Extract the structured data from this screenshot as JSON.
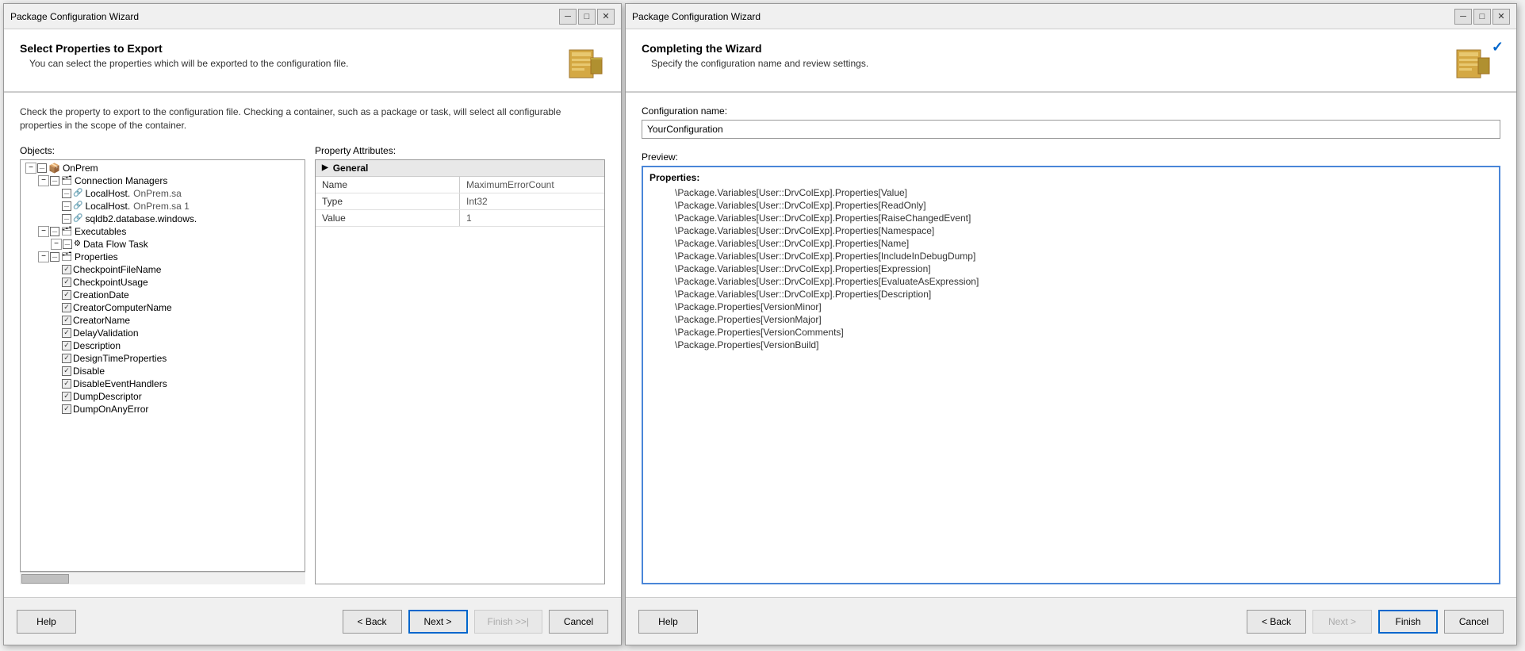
{
  "leftWizard": {
    "titleBar": {
      "title": "Package Configuration Wizard",
      "minimizeLabel": "─",
      "maximizeLabel": "□",
      "closeLabel": "✕"
    },
    "header": {
      "title": "Select Properties to Export",
      "subtitle": "You can select the properties which will be exported to the configuration file."
    },
    "description": "Check the property to export to the configuration file. Checking a container, such as a package or task, will select all configurable properties in the scope of the container.",
    "objectsLabel": "Objects:",
    "propertyAttributesLabel": "Property Attributes:",
    "tree": [
      {
        "level": 1,
        "checked": "indeterminate",
        "expanded": true,
        "text": "OnPrem",
        "type": "folder"
      },
      {
        "level": 2,
        "checked": "indeterminate",
        "expanded": true,
        "text": "Connection Managers",
        "type": "folder"
      },
      {
        "level": 3,
        "checked": "indeterminate",
        "expanded": false,
        "text": "LocalHost.",
        "value": "OnPrem.sa",
        "type": "leaf"
      },
      {
        "level": 3,
        "checked": "indeterminate",
        "expanded": false,
        "text": "LocalHost.",
        "value": "OnPrem.sa 1",
        "type": "leaf"
      },
      {
        "level": 3,
        "checked": "indeterminate",
        "expanded": false,
        "text": "",
        "value": "sqldb2.database.windows.",
        "type": "leaf"
      },
      {
        "level": 2,
        "checked": "indeterminate",
        "expanded": true,
        "text": "Executables",
        "type": "folder"
      },
      {
        "level": 3,
        "checked": "indeterminate",
        "expanded": true,
        "text": "Data Flow Task",
        "type": "folder"
      },
      {
        "level": 2,
        "checked": "indeterminate",
        "expanded": true,
        "text": "Properties",
        "type": "folder"
      },
      {
        "level": 3,
        "checked": "checked",
        "expanded": false,
        "text": "CheckpointFileName",
        "type": "prop"
      },
      {
        "level": 3,
        "checked": "checked",
        "expanded": false,
        "text": "CheckpointUsage",
        "type": "prop"
      },
      {
        "level": 3,
        "checked": "checked",
        "expanded": false,
        "text": "CreationDate",
        "type": "prop"
      },
      {
        "level": 3,
        "checked": "checked",
        "expanded": false,
        "text": "CreatorComputerName",
        "type": "prop"
      },
      {
        "level": 3,
        "checked": "checked",
        "expanded": false,
        "text": "CreatorName",
        "type": "prop"
      },
      {
        "level": 3,
        "checked": "checked",
        "expanded": false,
        "text": "DelayValidation",
        "type": "prop"
      },
      {
        "level": 3,
        "checked": "checked",
        "expanded": false,
        "text": "Description",
        "type": "prop"
      },
      {
        "level": 3,
        "checked": "checked",
        "expanded": false,
        "text": "DesignTimeProperties",
        "type": "prop"
      },
      {
        "level": 3,
        "checked": "checked",
        "expanded": false,
        "text": "Disable",
        "type": "prop"
      },
      {
        "level": 3,
        "checked": "checked",
        "expanded": false,
        "text": "DisableEventHandlers",
        "type": "prop"
      },
      {
        "level": 3,
        "checked": "checked",
        "expanded": false,
        "text": "DumpDescriptor",
        "type": "prop"
      },
      {
        "level": 3,
        "checked": "checked",
        "expanded": false,
        "text": "DumpOnAnyError",
        "type": "prop"
      }
    ],
    "propertySection": "General",
    "propertyRows": [
      {
        "label": "Name",
        "value": "MaximumErrorCount"
      },
      {
        "label": "Type",
        "value": "Int32"
      },
      {
        "label": "Value",
        "value": "1"
      }
    ],
    "footer": {
      "helpLabel": "Help",
      "backLabel": "< Back",
      "nextLabel": "Next >",
      "finishLabel": "Finish >>|",
      "cancelLabel": "Cancel"
    }
  },
  "rightWizard": {
    "titleBar": {
      "title": "Package Configuration Wizard",
      "minimizeLabel": "─",
      "maximizeLabel": "□",
      "closeLabel": "✕"
    },
    "header": {
      "title": "Completing the Wizard",
      "subtitle": "Specify the configuration name and review settings."
    },
    "configNameLabel": "Configuration name:",
    "configNameValue": "YourConfiguration",
    "previewLabel": "Preview:",
    "previewHeader": "Properties:",
    "previewItems": [
      "\\Package.Variables[User::DrvColExp].Properties[Value]",
      "\\Package.Variables[User::DrvColExp].Properties[ReadOnly]",
      "\\Package.Variables[User::DrvColExp].Properties[RaiseChangedEvent]",
      "\\Package.Variables[User::DrvColExp].Properties[Namespace]",
      "\\Package.Variables[User::DrvColExp].Properties[Name]",
      "\\Package.Variables[User::DrvColExp].Properties[IncludeInDebugDump]",
      "\\Package.Variables[User::DrvColExp].Properties[Expression]",
      "\\Package.Variables[User::DrvColExp].Properties[EvaluateAsExpression]",
      "\\Package.Variables[User::DrvColExp].Properties[Description]",
      "\\Package.Properties[VersionMinor]",
      "\\Package.Properties[VersionMajor]",
      "\\Package.Properties[VersionComments]",
      "\\Package.Properties[VersionBuild]"
    ],
    "footer": {
      "helpLabel": "Help",
      "backLabel": "< Back",
      "nextLabel": "Next >",
      "finishLabel": "Finish",
      "cancelLabel": "Cancel"
    }
  }
}
